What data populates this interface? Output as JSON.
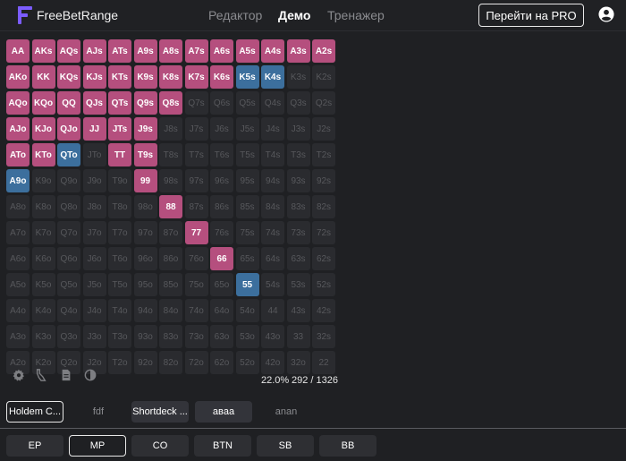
{
  "header": {
    "logo_text": "FreeBetRange",
    "nav": [
      "Редактор",
      "Демо",
      "Тренажер"
    ],
    "active_nav": "Демо",
    "pro_button": "Перейти на PRO"
  },
  "grid": {
    "rows": [
      [
        "AA",
        "AKs",
        "AQs",
        "AJs",
        "ATs",
        "A9s",
        "A8s",
        "A7s",
        "A6s",
        "A5s",
        "A4s",
        "A3s",
        "A2s"
      ],
      [
        "AKo",
        "KK",
        "KQs",
        "KJs",
        "KTs",
        "K9s",
        "K8s",
        "K7s",
        "K6s",
        "K5s",
        "K4s",
        "K3s",
        "K2s"
      ],
      [
        "AQo",
        "KQo",
        "QQ",
        "QJs",
        "QTs",
        "Q9s",
        "Q8s",
        "Q7s",
        "Q6s",
        "Q5s",
        "Q4s",
        "Q3s",
        "Q2s"
      ],
      [
        "AJo",
        "KJo",
        "QJo",
        "JJ",
        "JTs",
        "J9s",
        "J8s",
        "J7s",
        "J6s",
        "J5s",
        "J4s",
        "J3s",
        "J2s"
      ],
      [
        "ATo",
        "KTo",
        "QTo",
        "JTo",
        "TT",
        "T9s",
        "T8s",
        "T7s",
        "T6s",
        "T5s",
        "T4s",
        "T3s",
        "T2s"
      ],
      [
        "A9o",
        "K9o",
        "Q9o",
        "J9o",
        "T9o",
        "99",
        "98s",
        "97s",
        "96s",
        "95s",
        "94s",
        "93s",
        "92s"
      ],
      [
        "A8o",
        "K8o",
        "Q8o",
        "J8o",
        "T8o",
        "98o",
        "88",
        "87s",
        "86s",
        "85s",
        "84s",
        "83s",
        "82s"
      ],
      [
        "A7o",
        "K7o",
        "Q7o",
        "J7o",
        "T7o",
        "97o",
        "87o",
        "77",
        "76s",
        "75s",
        "74s",
        "73s",
        "72s"
      ],
      [
        "A6o",
        "K6o",
        "Q6o",
        "J6o",
        "T6o",
        "96o",
        "86o",
        "76o",
        "66",
        "65s",
        "64s",
        "63s",
        "62s"
      ],
      [
        "A5o",
        "K5o",
        "Q5o",
        "J5o",
        "T5o",
        "95o",
        "85o",
        "75o",
        "65o",
        "55",
        "54s",
        "53s",
        "52s"
      ],
      [
        "A4o",
        "K4o",
        "Q4o",
        "J4o",
        "T4o",
        "94o",
        "84o",
        "74o",
        "64o",
        "54o",
        "44",
        "43s",
        "42s"
      ],
      [
        "A3o",
        "K3o",
        "Q3o",
        "J3o",
        "T3o",
        "93o",
        "83o",
        "73o",
        "63o",
        "53o",
        "43o",
        "33",
        "32s"
      ],
      [
        "A2o",
        "K2o",
        "Q2o",
        "J2o",
        "T2o",
        "92o",
        "82o",
        "72o",
        "62o",
        "52o",
        "42o",
        "32o",
        "22"
      ]
    ],
    "raise_hands": [
      "AA",
      "AKs",
      "AQs",
      "AJs",
      "ATs",
      "A9s",
      "A8s",
      "A7s",
      "A6s",
      "A5s",
      "A4s",
      "A3s",
      "A2s",
      "AKo",
      "KK",
      "KQs",
      "KJs",
      "KTs",
      "K9s",
      "K8s",
      "K7s",
      "K6s",
      "AQo",
      "KQo",
      "QQ",
      "QJs",
      "QTs",
      "Q9s",
      "Q8s",
      "AJo",
      "KJo",
      "QJo",
      "JJ",
      "JTs",
      "J9s",
      "ATo",
      "KTo",
      "TT",
      "T9s",
      "99",
      "88",
      "77",
      "66"
    ],
    "call_hands": [
      "K5s",
      "K4s",
      "QTo",
      "A9o",
      "55"
    ]
  },
  "colors": {
    "raise": "#b54f7e",
    "call": "#3c6f9d",
    "empty": "#2a2b2f"
  },
  "toolbar": {
    "icons": [
      "gear-icon",
      "brush-icon",
      "document-icon",
      "contrast-icon"
    ],
    "percent": "22.0%",
    "combos": "292 / 1326"
  },
  "presets": [
    {
      "label": "Holdem C...",
      "style": "selected"
    },
    {
      "label": "fdf",
      "style": "link"
    },
    {
      "label": "Shortdeck ...",
      "style": "filled"
    },
    {
      "label": "авaa",
      "style": "filled"
    },
    {
      "label": "anan",
      "style": "link"
    }
  ],
  "positions": [
    {
      "label": "EP",
      "selected": false
    },
    {
      "label": "MP",
      "selected": true
    },
    {
      "label": "CO",
      "selected": false
    },
    {
      "label": "BTN",
      "selected": false
    },
    {
      "label": "SB",
      "selected": false
    },
    {
      "label": "BB",
      "selected": false
    }
  ]
}
